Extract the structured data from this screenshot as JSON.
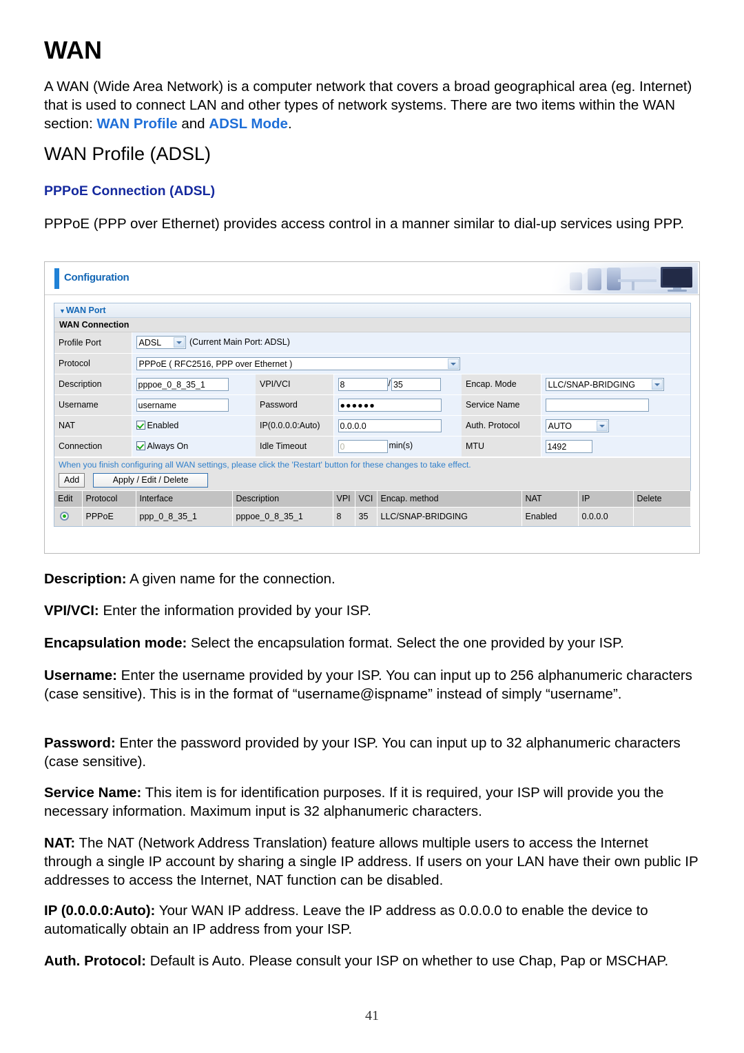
{
  "document": {
    "heading": "WAN",
    "intro_before": "A WAN (Wide Area Network) is a computer network that covers a broad geographical area (eg. Internet) that is used to connect LAN and other types of network systems. There are two items within the WAN section: ",
    "intro_link1": "WAN Profile",
    "intro_mid": " and ",
    "intro_link2": "ADSL Mode",
    "intro_after": ".",
    "subheading": "WAN Profile (ADSL)",
    "section_heading": "PPPoE Connection (ADSL)",
    "section_paragraph": "PPPoE (PPP over Ethernet) provides access control in a manner similar to dial-up services using PPP.",
    "page_number": "41",
    "definitions": [
      {
        "term": "Description:",
        "text": " A given name for the connection."
      },
      {
        "term": "VPI/VCI:",
        "text": " Enter the information provided by your ISP."
      },
      {
        "term": "Encapsulation mode:",
        "text": " Select the encapsulation format. Select the one provided by your ISP."
      },
      {
        "term": "Username:",
        "text": " Enter the username provided by your ISP. You can input up to 256 alphanumeric characters (case sensitive). This is in the format of “username@ispname” instead of simply “username”."
      },
      {
        "term": "Password:",
        "text": " Enter the password provided by your ISP. You can input up to 32 alphanumeric characters (case sensitive)."
      },
      {
        "term": "Service Name:",
        "text": " This item is for identification purposes. If it is required, your ISP will provide you the necessary information. Maximum input is 32 alphanumeric characters."
      },
      {
        "term": "NAT:",
        "text": " The NAT (Network Address Translation) feature allows multiple users to access the Internet through a single IP account by sharing a single IP address. If users on your LAN have their own public IP addresses to access the Internet, NAT function can be disabled."
      },
      {
        "term": "IP (0.0.0.0:Auto):",
        "text": " Your WAN IP address. Leave the IP address as 0.0.0.0 to enable the device to automatically obtain an IP address from your ISP."
      },
      {
        "term": "Auth. Protocol:",
        "text": " Default is Auto. Please consult your ISP on whether to use Chap, Pap or MSCHAP."
      }
    ]
  },
  "router_ui": {
    "header_title": "Configuration",
    "wan_port_section": "WAN Port",
    "wan_connection_section": "WAN Connection",
    "fields": {
      "profile_port_label": "Profile Port",
      "profile_port_value": "ADSL",
      "profile_port_hint": "(Current Main Port: ADSL)",
      "protocol_label": "Protocol",
      "protocol_value": "PPPoE ( RFC2516, PPP over Ethernet )",
      "description_label": "Description",
      "description_value": "pppoe_0_8_35_1",
      "vpivci_label": "VPI/VCI",
      "vpi_value": "8",
      "vci_separator": "/",
      "vci_value": "35",
      "encap_mode_label": "Encap. Mode",
      "encap_mode_value": "LLC/SNAP-BRIDGING",
      "username_label": "Username",
      "username_value": "username",
      "password_label": "Password",
      "password_value": "●●●●●●",
      "service_name_label": "Service Name",
      "service_name_value": "",
      "nat_label": "NAT",
      "nat_checkbox_label": "Enabled",
      "ip_label": "IP(0.0.0.0:Auto)",
      "ip_value": "0.0.0.0",
      "auth_protocol_label": "Auth. Protocol",
      "auth_protocol_value": "AUTO",
      "connection_label": "Connection",
      "connection_checkbox_label": "Always On",
      "idle_timeout_label": "Idle Timeout",
      "idle_timeout_value": "0",
      "idle_timeout_suffix": "min(s)",
      "mtu_label": "MTU",
      "mtu_value": "1492"
    },
    "note": "When you finish configuring all WAN settings, please click the 'Restart' button for these changes to take effect.",
    "buttons": {
      "add": "Add",
      "apply_edit_delete": "Apply / Edit / Delete"
    },
    "results_table": {
      "columns": [
        "Edit",
        "Protocol",
        "Interface",
        "Description",
        "VPI",
        "VCI",
        "Encap. method",
        "NAT",
        "IP",
        "Delete"
      ],
      "rows": [
        {
          "edit": "",
          "protocol": "PPPoE",
          "interface": "ppp_0_8_35_1",
          "description": "pppoe_0_8_35_1",
          "vpi": "8",
          "vci": "35",
          "encap_method": "LLC/SNAP-BRIDGING",
          "nat": "Enabled",
          "ip": "0.0.0.0",
          "delete": ""
        }
      ]
    }
  },
  "colors": {
    "link_blue": "#1f6fd8",
    "heading_navy": "#15299e",
    "ui_accent": "#1266b5",
    "note_blue": "#2f7fcb",
    "check_green": "#1aa81a"
  }
}
